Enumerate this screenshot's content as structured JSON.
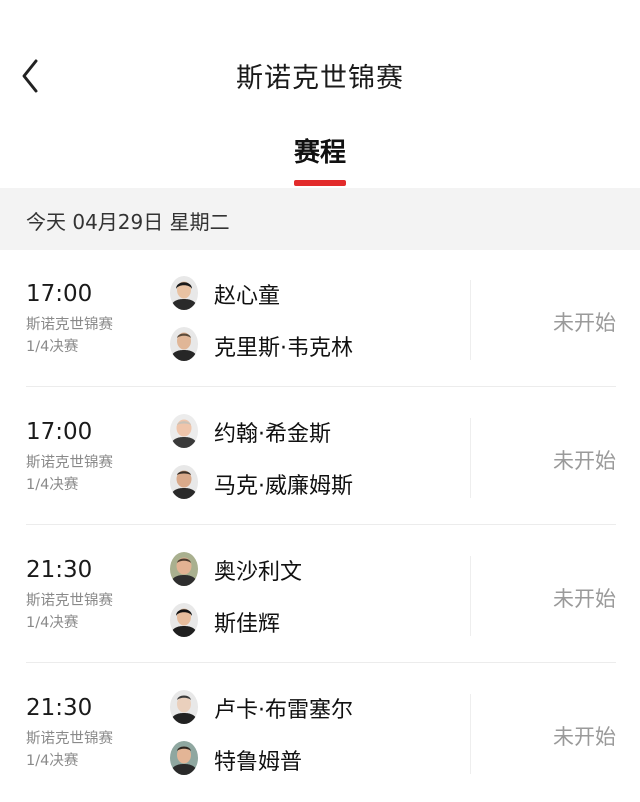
{
  "header": {
    "back_icon": "chevron-left-icon",
    "title": "斯诺克世锦赛"
  },
  "tabs": [
    {
      "label": "赛程",
      "active": true
    }
  ],
  "date_header": "今天 04月29日 星期二",
  "matches": [
    {
      "time": "17:00",
      "competition": "斯诺克世锦赛",
      "round": "1/4决赛",
      "players": [
        {
          "name": "赵心童",
          "avatar": "player-avatar"
        },
        {
          "name": "克里斯·韦克林",
          "avatar": "player-avatar"
        }
      ],
      "status": "未开始"
    },
    {
      "time": "17:00",
      "competition": "斯诺克世锦赛",
      "round": "1/4决赛",
      "players": [
        {
          "name": "约翰·希金斯",
          "avatar": "player-avatar"
        },
        {
          "name": "马克·威廉姆斯",
          "avatar": "player-avatar"
        }
      ],
      "status": "未开始"
    },
    {
      "time": "21:30",
      "competition": "斯诺克世锦赛",
      "round": "1/4决赛",
      "players": [
        {
          "name": "奥沙利文",
          "avatar": "player-avatar"
        },
        {
          "name": "斯佳辉",
          "avatar": "player-avatar"
        }
      ],
      "status": "未开始"
    },
    {
      "time": "21:30",
      "competition": "斯诺克世锦赛",
      "round": "1/4决赛",
      "players": [
        {
          "name": "卢卡·布雷塞尔",
          "avatar": "player-avatar"
        },
        {
          "name": "特鲁姆普",
          "avatar": "player-avatar"
        }
      ],
      "status": "未开始"
    }
  ],
  "colors": {
    "accent": "#e22b2b",
    "date_bar_bg": "#f3f3f3",
    "status_text": "#9a9a9a"
  }
}
